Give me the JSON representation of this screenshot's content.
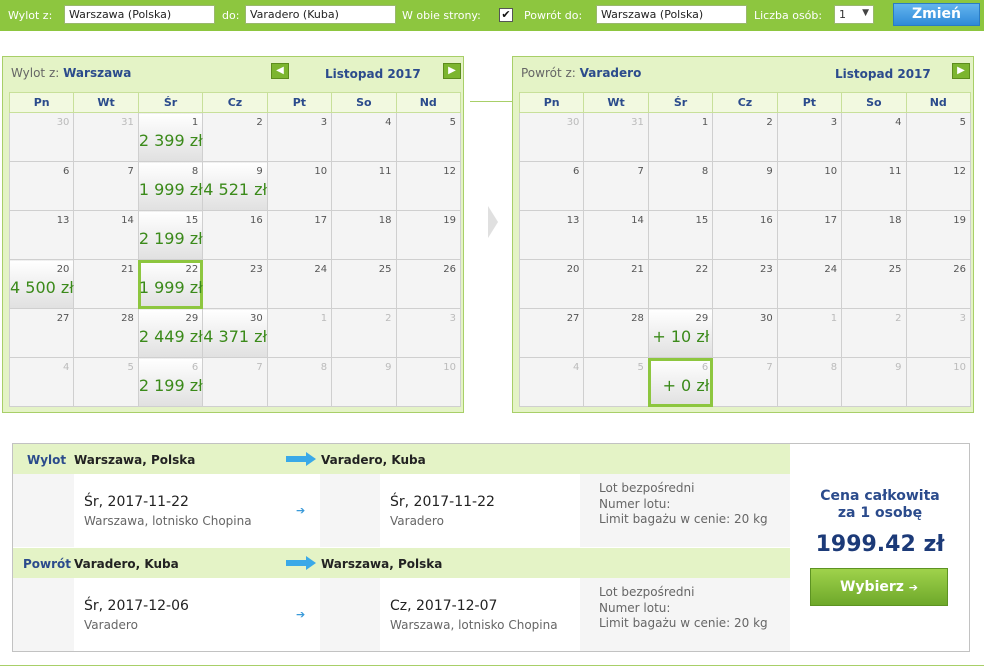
{
  "search": {
    "from_label": "Wylot z:",
    "from_value": "Warszawa (Polska)",
    "to_label": "do:",
    "to_value": "Varadero (Kuba)",
    "roundtrip_label": "W obie strony:",
    "roundtrip_checked": "✔",
    "return_label": "Powrót do:",
    "return_value": "Warszawa (Polska)",
    "persons_label": "Liczba osób:",
    "persons_value": "1",
    "change_button": "Zmień"
  },
  "outbound_calendar": {
    "title_prefix": "Wylot z:",
    "city": "Warszawa",
    "month": "Listopad 2017",
    "weekdays": [
      "Pn",
      "Wt",
      "Śr",
      "Cz",
      "Pt",
      "So",
      "Nd"
    ],
    "weeks": [
      [
        {
          "d": "30",
          "o": true
        },
        {
          "d": "31",
          "o": true
        },
        {
          "d": "1",
          "p": "2 399 zł"
        },
        {
          "d": "2"
        },
        {
          "d": "3"
        },
        {
          "d": "4"
        },
        {
          "d": "5"
        }
      ],
      [
        {
          "d": "6"
        },
        {
          "d": "7"
        },
        {
          "d": "8",
          "p": "1 999 zł"
        },
        {
          "d": "9",
          "p": "4 521 zł"
        },
        {
          "d": "10"
        },
        {
          "d": "11"
        },
        {
          "d": "12"
        }
      ],
      [
        {
          "d": "13"
        },
        {
          "d": "14"
        },
        {
          "d": "15",
          "p": "2 199 zł"
        },
        {
          "d": "16"
        },
        {
          "d": "17"
        },
        {
          "d": "18"
        },
        {
          "d": "19"
        }
      ],
      [
        {
          "d": "20",
          "p": "4 500 zł"
        },
        {
          "d": "21"
        },
        {
          "d": "22",
          "p": "1 999 zł",
          "s": true
        },
        {
          "d": "23"
        },
        {
          "d": "24"
        },
        {
          "d": "25"
        },
        {
          "d": "26"
        }
      ],
      [
        {
          "d": "27"
        },
        {
          "d": "28"
        },
        {
          "d": "29",
          "p": "2 449 zł"
        },
        {
          "d": "30",
          "p": "4 371 zł"
        },
        {
          "d": "1",
          "o": true
        },
        {
          "d": "2",
          "o": true
        },
        {
          "d": "3",
          "o": true
        }
      ],
      [
        {
          "d": "4",
          "o": true
        },
        {
          "d": "5",
          "o": true
        },
        {
          "d": "6",
          "o": true,
          "p": "2 199 zł"
        },
        {
          "d": "7",
          "o": true
        },
        {
          "d": "8",
          "o": true
        },
        {
          "d": "9",
          "o": true
        },
        {
          "d": "10",
          "o": true
        }
      ]
    ]
  },
  "return_calendar": {
    "title_prefix": "Powrót z:",
    "city": "Varadero",
    "month": "Listopad 2017",
    "weekdays": [
      "Pn",
      "Wt",
      "Śr",
      "Cz",
      "Pt",
      "So",
      "Nd"
    ],
    "weeks": [
      [
        {
          "d": "30",
          "o": true
        },
        {
          "d": "31",
          "o": true
        },
        {
          "d": "1"
        },
        {
          "d": "2"
        },
        {
          "d": "3"
        },
        {
          "d": "4"
        },
        {
          "d": "5"
        }
      ],
      [
        {
          "d": "6"
        },
        {
          "d": "7"
        },
        {
          "d": "8"
        },
        {
          "d": "9"
        },
        {
          "d": "10"
        },
        {
          "d": "11"
        },
        {
          "d": "12"
        }
      ],
      [
        {
          "d": "13"
        },
        {
          "d": "14"
        },
        {
          "d": "15"
        },
        {
          "d": "16"
        },
        {
          "d": "17"
        },
        {
          "d": "18"
        },
        {
          "d": "19"
        }
      ],
      [
        {
          "d": "20"
        },
        {
          "d": "21"
        },
        {
          "d": "22"
        },
        {
          "d": "23"
        },
        {
          "d": "24"
        },
        {
          "d": "25"
        },
        {
          "d": "26"
        }
      ],
      [
        {
          "d": "27"
        },
        {
          "d": "28"
        },
        {
          "d": "29",
          "p": "+ 10 zł"
        },
        {
          "d": "30"
        },
        {
          "d": "1",
          "o": true
        },
        {
          "d": "2",
          "o": true
        },
        {
          "d": "3",
          "o": true
        }
      ],
      [
        {
          "d": "4",
          "o": true
        },
        {
          "d": "5",
          "o": true
        },
        {
          "d": "6",
          "o": true,
          "p": "+ 0 zł",
          "s": true
        },
        {
          "d": "7",
          "o": true
        },
        {
          "d": "8",
          "o": true
        },
        {
          "d": "9",
          "o": true
        },
        {
          "d": "10",
          "o": true
        }
      ]
    ]
  },
  "summary": {
    "outbound": {
      "label": "Wylot",
      "from": "Warszawa, Polska",
      "to": "Varadero, Kuba",
      "dep_date": "Śr, 2017-11-22",
      "dep_airport": "Warszawa, lotnisko Chopina",
      "arr_date": "Śr, 2017-11-22",
      "arr_airport": "Varadero",
      "info1": "Lot bezpośredni",
      "info2": "Numer lotu:",
      "info3": "Limit bagażu w cenie: 20 kg"
    },
    "return": {
      "label": "Powrót",
      "from": "Varadero, Kuba",
      "to": "Warszawa, Polska",
      "dep_date": "Śr, 2017-12-06",
      "dep_airport": "Varadero",
      "arr_date": "Cz, 2017-12-07",
      "arr_airport": "Warszawa, lotnisko Chopina",
      "info1": "Lot bezpośredni",
      "info2": "Numer lotu:",
      "info3": "Limit bagażu w cenie: 20 kg"
    },
    "price_label_1": "Cena całkowita",
    "price_label_2": "za 1 osobę",
    "price": "1999.42 zł",
    "select_button": "Wybierz",
    "select_icon": "➔"
  },
  "colors": {
    "accent_green": "#8dc63f",
    "panel_green": "#e4f3c6",
    "heading_blue": "#2b4b8c",
    "price_green": "#3b8a1a",
    "button_blue": "#2f8ad8"
  },
  "icons": {
    "prev_month": "arrow-left-icon",
    "next_month": "arrow-right-icon",
    "route_arrow": "route-arrow-icon",
    "small_arrow": "chevron-right-icon"
  }
}
